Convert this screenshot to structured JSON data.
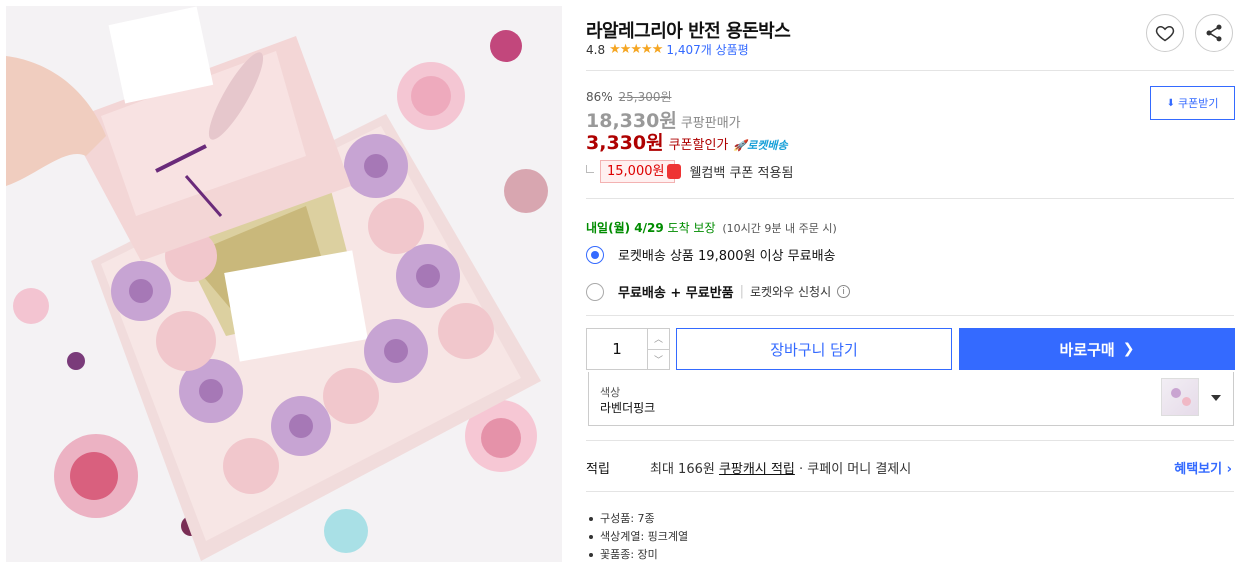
{
  "product": {
    "title": "라알레그리아 반전 용돈박스",
    "rating": "4.8",
    "stars": "★★★★★",
    "review_count": "1,407개 상품평"
  },
  "price": {
    "discount_rate": "86%",
    "original": "25,300원",
    "sale": "18,330원",
    "sale_label": "쿠팡판매가",
    "coupon_price": "3,330원",
    "coupon_label": "쿠폰할인가",
    "rocket_label": "로켓배송",
    "welcome_amount": "15,000원",
    "welcome_text": "웰컴백 쿠폰 적용됨",
    "coupon_button": "쿠폰받기"
  },
  "delivery": {
    "arrival": "내일(월) 4/29",
    "arrival_suffix": "도착 보장",
    "condition": "(10시간 9분 내 주문 시)",
    "option1": "로켓배송 상품 19,800원 이상 무료배송",
    "option2_main": "무료배송 + 무료반품",
    "option2_sub": "로켓와우 신청시"
  },
  "purchase": {
    "quantity": "1",
    "cart_button": "장바구니 담기",
    "buy_button": "바로구매",
    "option_label": "색상",
    "option_value": "라벤더핑크"
  },
  "reward": {
    "label": "적립",
    "prefix": "최대 166원",
    "link": "쿠팡캐시 적립",
    "suffix": "· 쿠페이 머니 결제시",
    "more": "혜택보기"
  },
  "specs": [
    "구성품: 7종",
    "색상계열: 핑크계열",
    "꽃품종: 장미"
  ],
  "colors": {
    "accent": "#346aff",
    "price_red": "#ae0000",
    "green": "#008c00",
    "star": "#f5a623"
  }
}
